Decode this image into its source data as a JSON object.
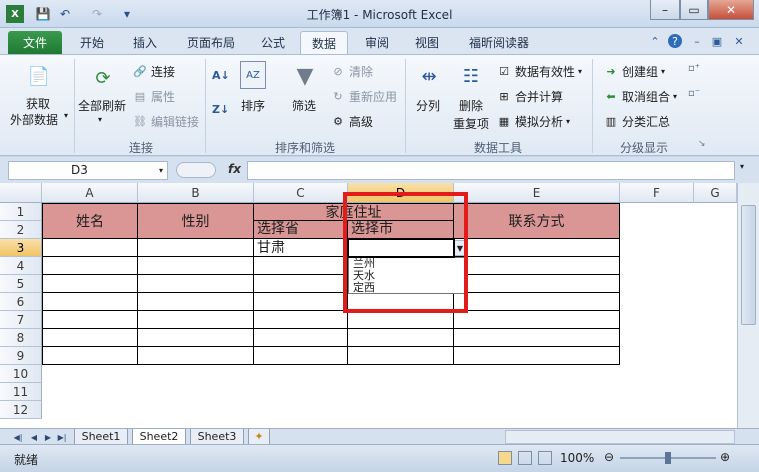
{
  "window": {
    "title": "工作簿1 - Microsoft Excel",
    "minimize": "–",
    "maximize": "▭",
    "close": "✕"
  },
  "qat": {
    "save": "💾",
    "undo": "↶",
    "redo": "↷",
    "customize": "▾"
  },
  "tabs": [
    "文件",
    "开始",
    "插入",
    "页面布局",
    "公式",
    "数据",
    "审阅",
    "视图",
    "福昕阅读器"
  ],
  "ribbon": {
    "get_external": {
      "line1": "获取",
      "line2": "外部数据"
    },
    "refresh_all": "全部刷新",
    "connections": "连接",
    "properties": "属性",
    "edit_links": "编辑链接",
    "group_connections": "连接",
    "sort": "排序",
    "filter": "筛选",
    "clear": "清除",
    "reapply": "重新应用",
    "advanced": "高级",
    "group_sortfilter": "排序和筛选",
    "text_to_columns": "分列",
    "remove_dup": {
      "line1": "删除",
      "line2": "重复项"
    },
    "data_validation": "数据有效性",
    "consolidate": "合并计算",
    "whatif": "模拟分析",
    "group_datatools": "数据工具",
    "group": "创建组",
    "ungroup": "取消组合",
    "subtotal": "分类汇总",
    "group_outline": "分级显示"
  },
  "formula": {
    "namebox": "D3",
    "fx": "fx",
    "value": ""
  },
  "columns": [
    "A",
    "B",
    "C",
    "D",
    "E",
    "F",
    "G"
  ],
  "rows": [
    "1",
    "2",
    "3",
    "4",
    "5",
    "6",
    "7",
    "8",
    "9",
    "10",
    "11",
    "12"
  ],
  "cells": {
    "name": "姓名",
    "gender": "性别",
    "address": "家庭住址",
    "province": "选择省",
    "city": "选择市",
    "contact": "联系方式",
    "c3": "甘肃"
  },
  "dropdown": {
    "options": [
      "兰州",
      "天水",
      "定西"
    ]
  },
  "sheets": [
    "Sheet1",
    "Sheet2",
    "Sheet3"
  ],
  "status": {
    "ready": "就绪",
    "zoom": "100%"
  },
  "colors": {
    "header_fill": "#d99695",
    "highlight": "#e21b1b"
  }
}
